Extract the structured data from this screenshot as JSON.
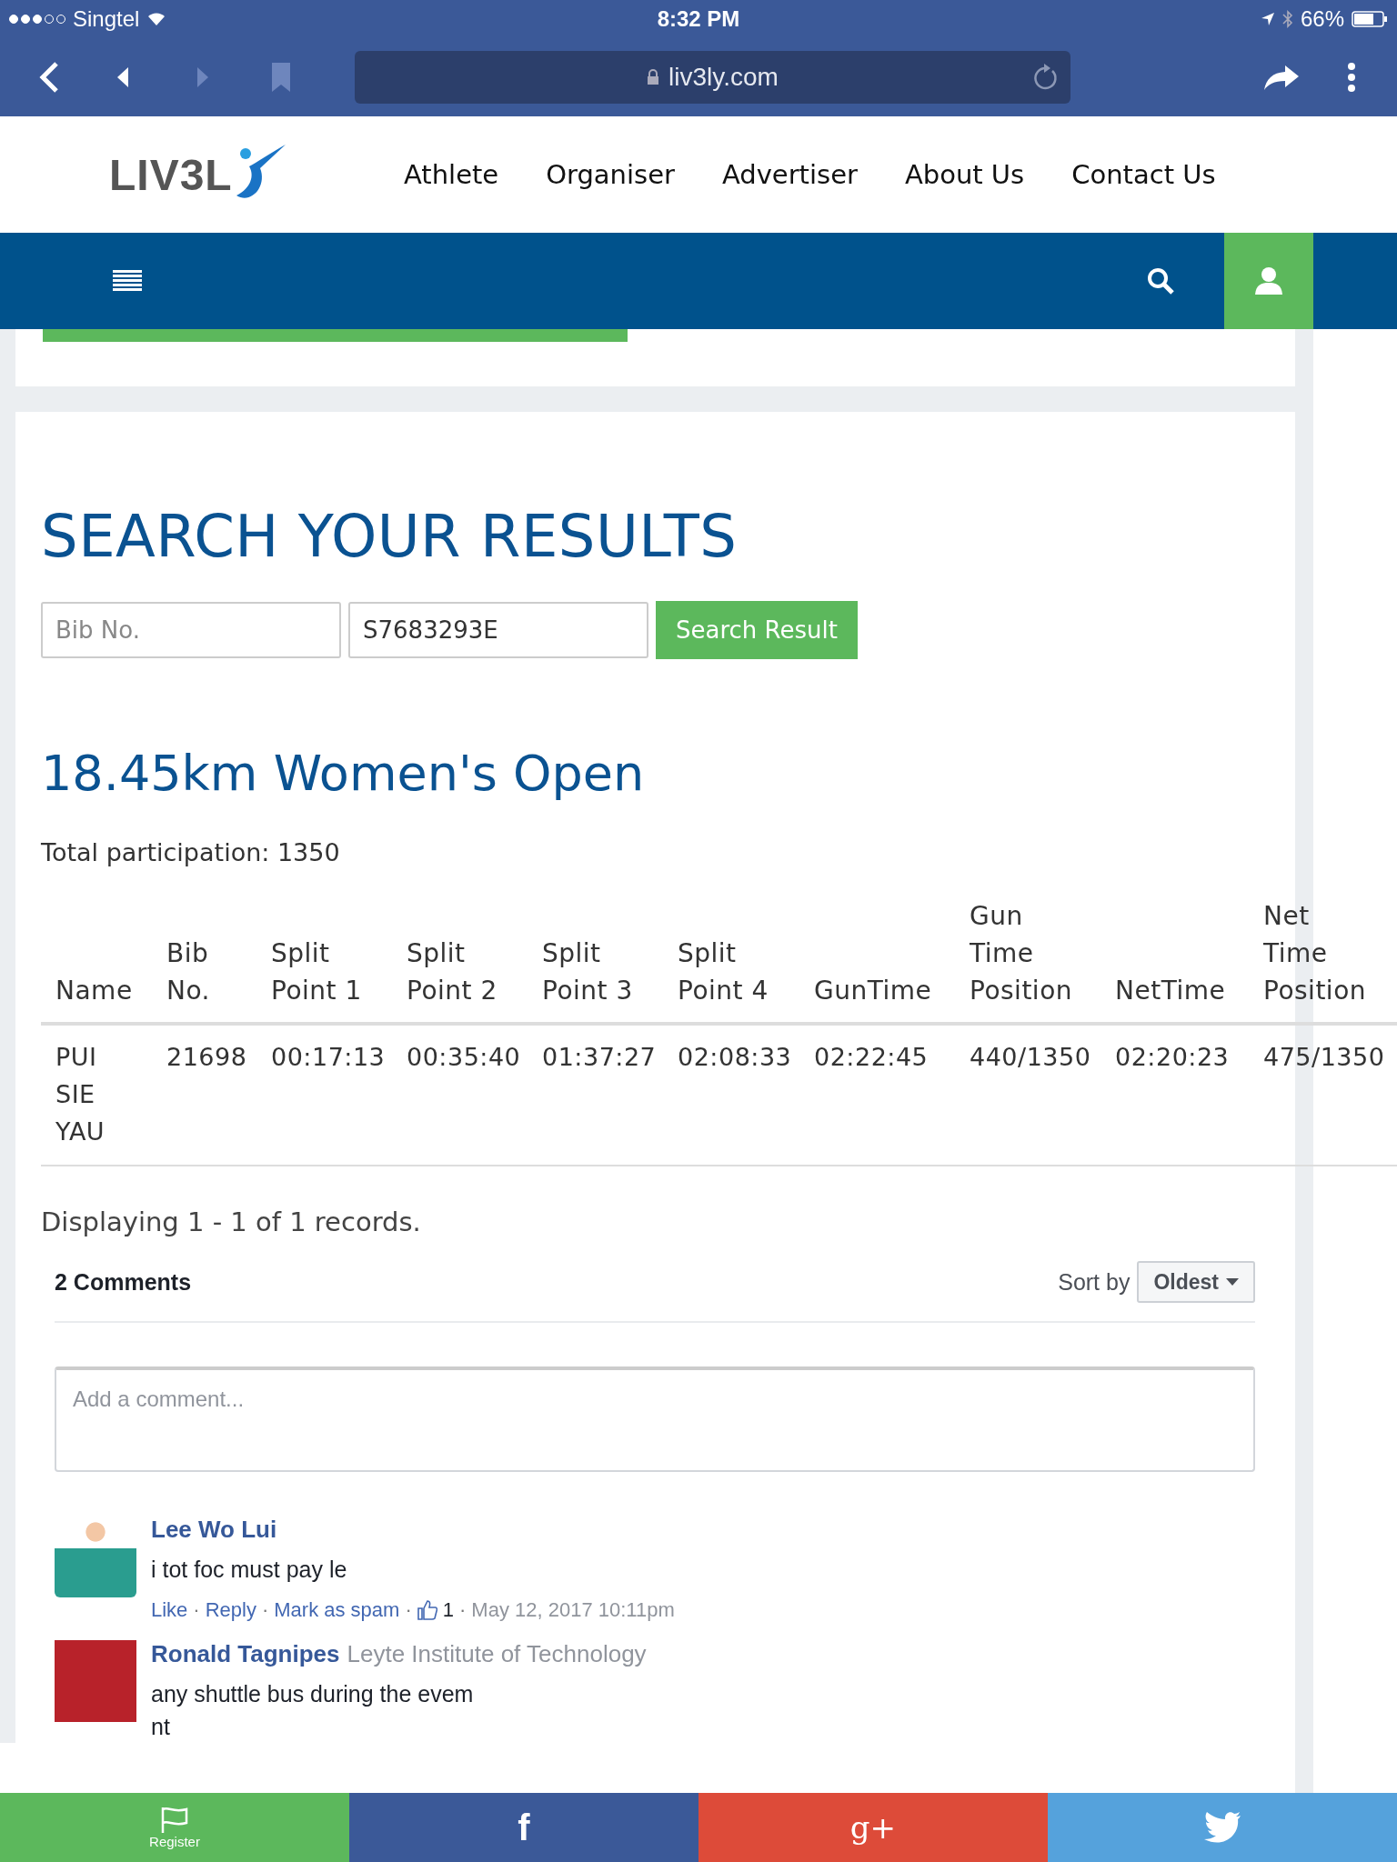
{
  "status_bar": {
    "carrier": "Singtel",
    "time": "8:32 PM",
    "battery": "66%"
  },
  "browser": {
    "url": "liv3ly.com"
  },
  "site_nav": {
    "logo": "LIV3L",
    "links": [
      "Athlete",
      "Organiser",
      "Advertiser",
      "About Us",
      "Contact Us"
    ]
  },
  "search": {
    "title": "SEARCH YOUR RESULTS",
    "fields": [
      {
        "placeholder": "Bib No."
      },
      {
        "value": "S7683293E"
      }
    ],
    "button": "Search Result"
  },
  "results": {
    "title": "18.45km Women's Open",
    "participation": "Total participation: 1350",
    "table": {
      "columns": [
        "Name",
        "Bib No.",
        "Split Point 1",
        "Split Point 2",
        "Split Point 3",
        "Split Point 4",
        "GunTime",
        "Gun Time Position",
        "NetTime",
        "Net Time Position"
      ],
      "rows": [
        [
          "PUI SIE YAU",
          "21698",
          "00:17:13",
          "00:35:40",
          "01:37:27",
          "02:08:33",
          "02:22:45",
          "440/1350",
          "02:20:23",
          "475/1350"
        ]
      ]
    },
    "footer": "Displaying 1 - 1 of 1 records."
  },
  "comments": {
    "count": "2 Comments",
    "sort_label": "Sort by",
    "sort_value": "Oldest",
    "input": {
      "placeholder": "Add a comment..."
    },
    "items": [
      {
        "author": "Lee Wo Lui",
        "text": "i tot foc must pay le",
        "actions": [
          "Like",
          "Reply",
          "Mark as spam"
        ],
        "separator": "·",
        "likes": "1",
        "date": "May 12, 2017 10:11pm"
      },
      {
        "author": "Ronald Tagnipes",
        "affiliation": "Leyte Institute of Technology",
        "text": "any shuttle bus during the evem\nnt"
      }
    ]
  },
  "bottom_bar": [
    {
      "kind": "register",
      "label": "Register"
    },
    {
      "kind": "facebook",
      "label": "f"
    },
    {
      "kind": "google",
      "label": "g+"
    },
    {
      "kind": "twitter"
    }
  ]
}
